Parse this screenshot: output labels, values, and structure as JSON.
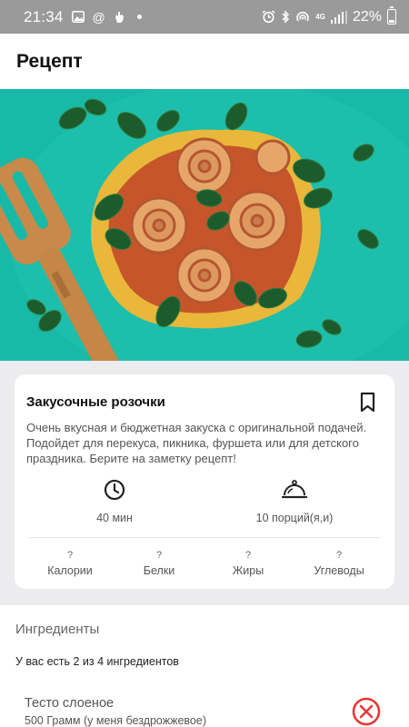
{
  "status_bar": {
    "time": "21:34",
    "network": "4G",
    "battery": "22%",
    "icons": [
      "image-icon",
      "at-icon",
      "hand-icon",
      "notification-dot",
      "alarm-icon",
      "bluetooth-icon",
      "hotspot-icon",
      "signal-icon",
      "battery-icon"
    ]
  },
  "header": {
    "title": "Рецепт"
  },
  "hero": {
    "image": "pastry-roses-photo"
  },
  "recipe": {
    "title": "Закусочные розочки",
    "description": "Очень вкусная и бюджетная закуска с оригинальной подачей. Подойдет для перекуса, пикника, фуршета или для детского праздника. Берите на заметку рецепт!",
    "time": "40 мин",
    "servings": "10 порций(я,и)",
    "nutrition": [
      {
        "value": "?",
        "label": "Калории"
      },
      {
        "value": "?",
        "label": "Белки"
      },
      {
        "value": "?",
        "label": "Жиры"
      },
      {
        "value": "?",
        "label": "Углеводы"
      }
    ]
  },
  "ingredients": {
    "title": "Ингредиенты",
    "summary": "У вас есть 2 из 4 ингредиентов",
    "items": [
      {
        "name": "Тесто слоеное",
        "amount": "500 Грамм (у меня бездрожжевое)",
        "have": false
      }
    ]
  },
  "colors": {
    "accent_remove": "#e53935",
    "hero_bg": "#17b7a6",
    "status_bar": "#9a9a9a"
  }
}
